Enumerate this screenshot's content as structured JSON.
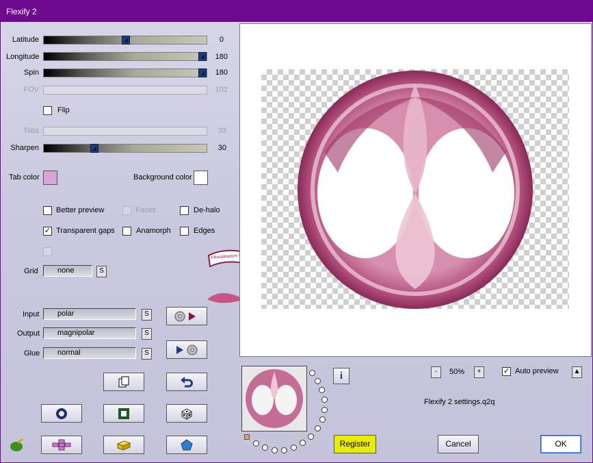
{
  "window": {
    "title": "Flexify 2"
  },
  "sliders": {
    "latitude": {
      "label": "Latitude",
      "value": "0",
      "fraction": 0.5
    },
    "longitude": {
      "label": "Longitude",
      "value": "180",
      "fraction": 1.0
    },
    "spin": {
      "label": "Spin",
      "value": "180",
      "fraction": 1.0
    },
    "fov": {
      "label": "FOV",
      "value": "102",
      "fraction": 0.57
    },
    "tabs": {
      "label": "Tabs",
      "value": "33",
      "fraction": 0.33
    },
    "sharpen": {
      "label": "Sharpen",
      "value": "30",
      "fraction": 0.3
    }
  },
  "flip": {
    "label": "Flip",
    "checked": false
  },
  "colors": {
    "tab_color_label": "Tab color",
    "tab_color": "#d7a3d8",
    "background_color_label": "Background color",
    "background_color": "#ffffff",
    "accent_purple": "#6e0a8e",
    "slider_thumb": "#1b3f7c"
  },
  "options": {
    "better_preview": {
      "label": "Better preview",
      "checked": false
    },
    "faces": {
      "label": "Faces",
      "checked": false,
      "disabled": true
    },
    "de_halo": {
      "label": "De-halo",
      "checked": false
    },
    "transparent_gaps": {
      "label": "Transparent gaps",
      "checked": true
    },
    "anamorph": {
      "label": "Anamorph",
      "checked": false
    },
    "edges": {
      "label": "Edges",
      "checked": false
    }
  },
  "grid": {
    "label": "Grid",
    "value": "none",
    "s_label": "S"
  },
  "projection": {
    "input_label": "Input",
    "input_value": "polar",
    "output_label": "Output",
    "output_value": "magnipolar",
    "glue_label": "Glue",
    "glue_value": "normal",
    "s_label": "S"
  },
  "zoom": {
    "minus": "-",
    "value": "50%",
    "plus": "+"
  },
  "auto_preview": {
    "label": "Auto preview",
    "checked": true,
    "toggle": "▲"
  },
  "info_label": "i",
  "settings_file": "Flexify 2 settings.q2q",
  "watermark": "©Rosalifoptom Vion",
  "buttons": {
    "register": "Register",
    "cancel": "Cancel",
    "ok": "OK"
  }
}
